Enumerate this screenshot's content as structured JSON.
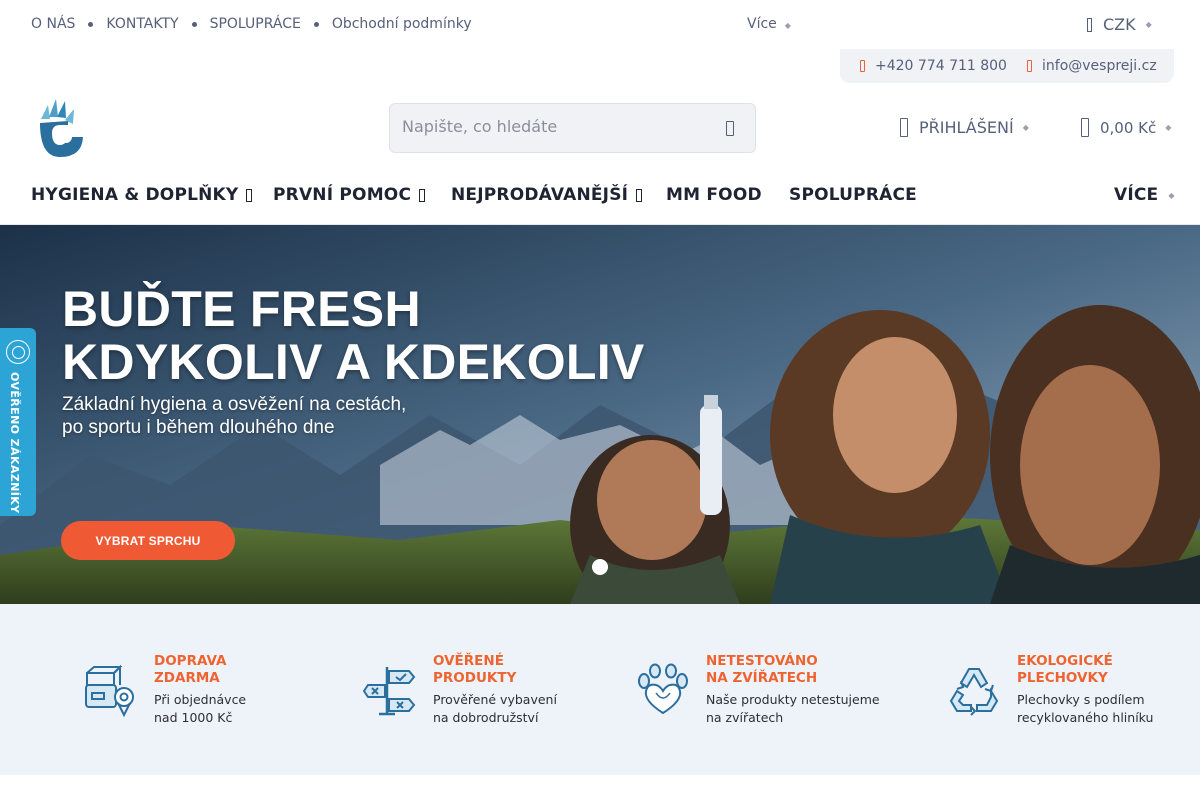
{
  "topbar": {
    "links": [
      "O NÁS",
      "KONTAKTY",
      "SPOLUPRÁCE",
      "Obchodní podmínky"
    ],
    "more": "Více",
    "currency": "CZK"
  },
  "contact": {
    "phone": "+420 774 711 800",
    "email": "info@vespreji.cz"
  },
  "search": {
    "placeholder": "Napište, co hledáte"
  },
  "header": {
    "login_label": "PŘIHLÁŠENÍ",
    "cart_total": "0,00 Kč"
  },
  "nav": {
    "items": [
      "HYGIENA & DOPLŇKY",
      "PRVNÍ POMOC",
      "NEJPRODÁVANĚJŠÍ",
      "MM FOOD",
      "SPOLUPRÁCE"
    ],
    "more": "VÍCE"
  },
  "hero": {
    "title_line1": "BUĎTE FRESH",
    "title_line2": "KDYKOLIV A KDEKOLIV",
    "subtitle_line1": "Základní hygiena a osvěžení na cestách,",
    "subtitle_line2": "po sportu i během dlouhého dne",
    "cta_label": "VYBRAT SPRCHU"
  },
  "verified_badge": {
    "label": "OVĚŘENO ZÁKAZNÍKY"
  },
  "benefits": [
    {
      "title_line1": "DOPRAVA",
      "title_line2": "ZDARMA",
      "desc_line1": "Při objednávce",
      "desc_line2": "nad 1000 Kč",
      "icon": "delivery-box-icon"
    },
    {
      "title_line1": "OVĚŘENÉ",
      "title_line2": "PRODUKTY",
      "desc_line1": "Prověřené vybavení",
      "desc_line2": "na dobrodružství",
      "icon": "signpost-icon"
    },
    {
      "title_line1": "NETESTOVÁNO",
      "title_line2": "NA ZVÍŘATECH",
      "desc_line1": "Naše produkty netestujeme",
      "desc_line2": "na zvířatech",
      "icon": "paw-heart-icon"
    },
    {
      "title_line1": "EKOLOGICKÉ",
      "title_line2": "PLECHOVKY",
      "desc_line1": "Plechovky s podílem",
      "desc_line2": "recyklovaného hliníku",
      "icon": "recycle-icon"
    }
  ],
  "colors": {
    "accent": "#ef5a34",
    "benefit_title": "#ee6431",
    "badge": "#2ca5d6",
    "logo_blue": "#2a6f9e"
  }
}
